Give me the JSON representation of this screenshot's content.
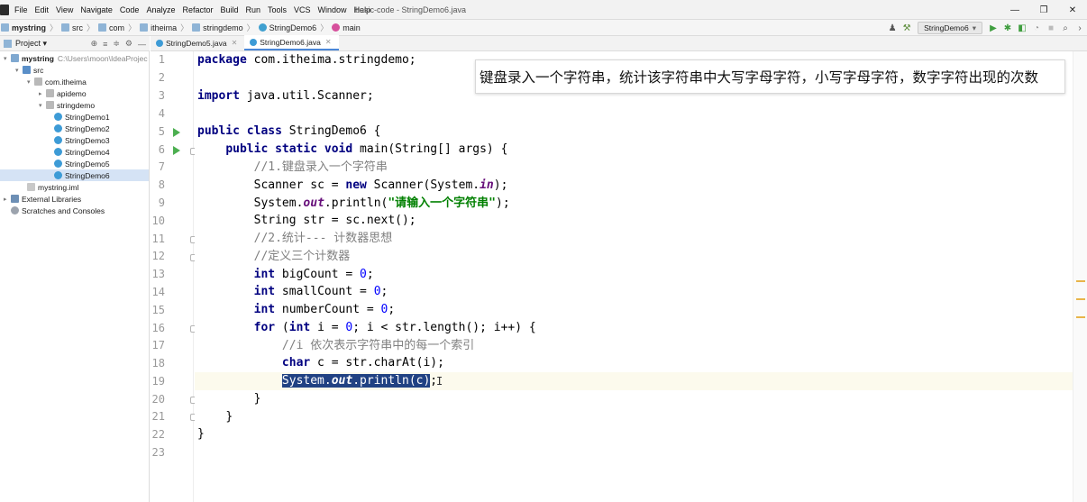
{
  "menubar": {
    "items": [
      "File",
      "Edit",
      "View",
      "Navigate",
      "Code",
      "Analyze",
      "Refactor",
      "Build",
      "Run",
      "Tools",
      "VCS",
      "Window",
      "Help"
    ],
    "title": "basic-code - StringDemo6.java",
    "controls": [
      "—",
      "❐",
      "✕"
    ]
  },
  "breadcrumb": {
    "items": [
      "mystring",
      "src",
      "com",
      "itheima",
      "stringdemo",
      "StringDemo6",
      "main"
    ]
  },
  "toolbar": {
    "run_config": "StringDemo6"
  },
  "project_panel": {
    "title": "Project",
    "tree": [
      {
        "label": "mystring",
        "muted": "C:\\Users\\moon\\IdeaProjec"
      },
      {
        "label": "src"
      },
      {
        "label": "com.itheima"
      },
      {
        "label": "apidemo"
      },
      {
        "label": "stringdemo"
      },
      {
        "label": "StringDemo1"
      },
      {
        "label": "StringDemo2"
      },
      {
        "label": "StringDemo3"
      },
      {
        "label": "StringDemo4"
      },
      {
        "label": "StringDemo5"
      },
      {
        "label": "StringDemo6"
      },
      {
        "label": "mystring.iml"
      },
      {
        "label": "External Libraries"
      },
      {
        "label": "Scratches and Consoles"
      }
    ]
  },
  "tabs": [
    {
      "label": "StringDemo5.java"
    },
    {
      "label": "StringDemo6.java",
      "active": true
    }
  ],
  "editor": {
    "line_numbers": [
      "1",
      "2",
      "3",
      "4",
      "5",
      "6",
      "7",
      "8",
      "9",
      "10",
      "11",
      "12",
      "13",
      "14",
      "15",
      "16",
      "17",
      "18",
      "19",
      "20",
      "21",
      "22",
      "23"
    ],
    "code": {
      "l1_kw": "package",
      "l1_rest": " com.itheima.stringdemo;",
      "l3_kw": "import",
      "l3_rest": " java.util.Scanner;",
      "l5_kw1": "public",
      "l5_kw2": "class",
      "l5_rest": " StringDemo6 {",
      "l6_kw1": "public",
      "l6_kw2": "static",
      "l6_kw3": "void",
      "l6_rest": " main(String[] args) {",
      "l7_cmt": "//1.键盘录入一个字符串",
      "l8_a": "Scanner sc = ",
      "l8_kw": "new",
      "l8_b": " Scanner(",
      "l8_cls": "System",
      "l8_dot": ".",
      "l8_in": "in",
      "l8_c": ");",
      "l9_cls": "System",
      "l9_dot": ".",
      "l9_out": "out",
      "l9_a": ".println(",
      "l9_str": "\"请输入一个字符串\"",
      "l9_b": ");",
      "l10": "String str = sc.next();",
      "l11_cmt": "//2.统计--- 计数器思想",
      "l12_cmt": "//定义三个计数器",
      "l13_kw": "int",
      "l13_a": " bigCount = ",
      "l13_num": "0",
      "l13_b": ";",
      "l14_kw": "int",
      "l14_a": " smallCount = ",
      "l14_num": "0",
      "l14_b": ";",
      "l15_kw": "int",
      "l15_a": " numberCount = ",
      "l15_num": "0",
      "l15_b": ";",
      "l16_kw": "for",
      "l16_a": " (",
      "l16_kw2": "int",
      "l16_b": " i = ",
      "l16_num": "0",
      "l16_c": "; i < str.length(); i++) {",
      "l17_cmt": "//i 依次表示字符串中的每一个索引",
      "l18_kw": "char",
      "l18_a": " c = str.charAt(i);",
      "l19_cls": "System",
      "l19_dot": ".",
      "l19_out": "out",
      "l19_a": ".println(c)",
      "l19_b": ";",
      "l20": "}",
      "l21": "}",
      "l22": "}"
    }
  },
  "caption": "键盘录入一个字符串，统计该字符串中大写字母字符，小写字母字符，数字字符出现的次数"
}
